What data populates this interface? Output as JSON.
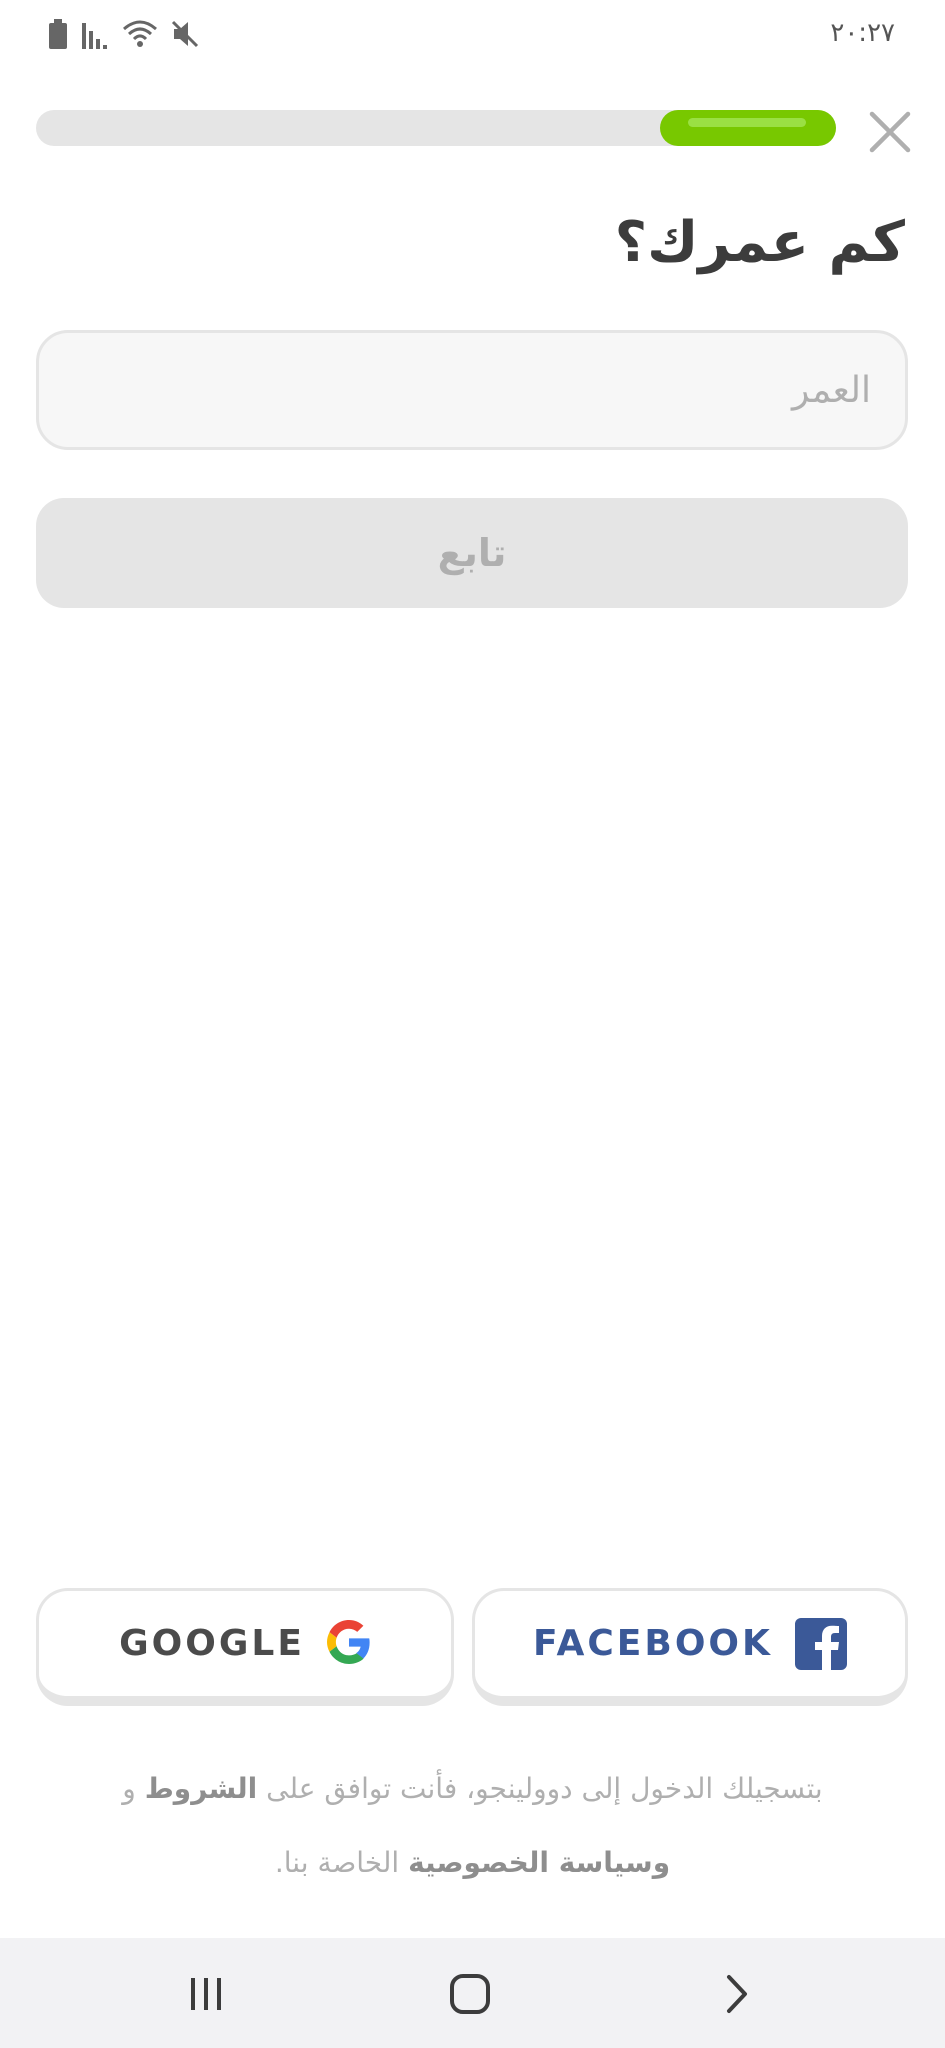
{
  "status_bar": {
    "time": "٢٠:٢٧",
    "icons": [
      "battery-icon",
      "signal-icon",
      "wifi-icon",
      "mute-icon"
    ]
  },
  "progress": {
    "fraction": 0.22
  },
  "header": {
    "close_icon": "close-icon"
  },
  "question": {
    "title": "كم عمرك؟"
  },
  "age_input": {
    "placeholder": "العمر",
    "value": ""
  },
  "continue_button": {
    "label": "تابع"
  },
  "social": {
    "google_label": "GOOGLE",
    "facebook_label": "FACEBOOK"
  },
  "legal": {
    "part1": "بتسجيلك الدخول إلى دوولينجو، فأنت توافق على ",
    "terms": "الشروط",
    "part2": " و ",
    "privacy": "وسياسة الخصوصية",
    "part3": " الخاصة بنا."
  },
  "nav_bar": {
    "recents_icon": "recents-icon",
    "home_icon": "home-icon",
    "back_icon": "back-icon"
  },
  "colors": {
    "progress": "#78c800",
    "track": "#e5e5e5",
    "facebook": "#3b5998",
    "text": "#3c3c3c",
    "muted": "#afafaf"
  }
}
